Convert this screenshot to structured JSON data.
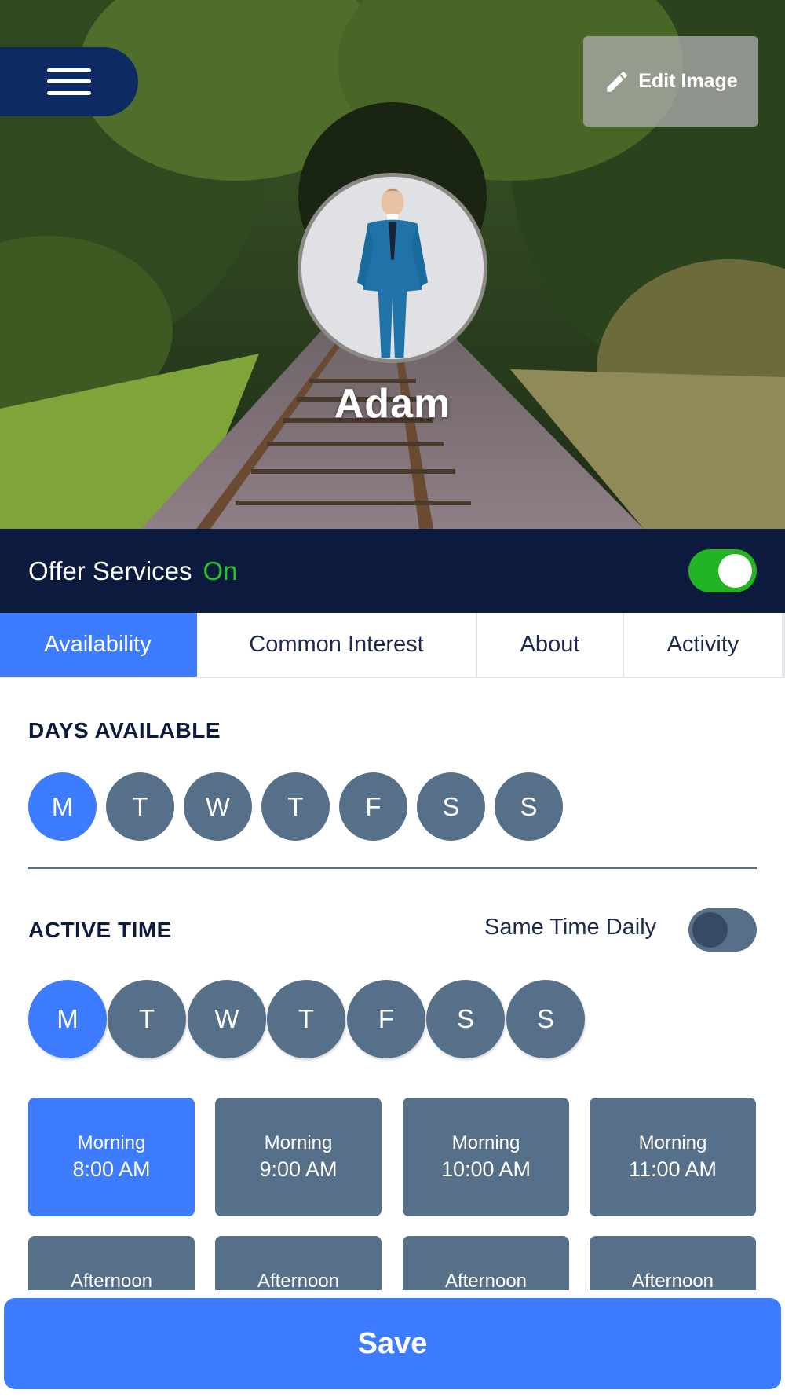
{
  "header": {
    "menu_icon": "hamburger-menu-icon",
    "edit_image_label": "Edit Image",
    "edit_icon": "pencil-icon",
    "profile_name": "Adam"
  },
  "offer_services": {
    "label": "Offer Services",
    "status": "On",
    "enabled": true,
    "status_color": "#27c227"
  },
  "tabs": [
    {
      "label": "Availability",
      "active": true
    },
    {
      "label": "Common Interest",
      "active": false
    },
    {
      "label": "About",
      "active": false
    },
    {
      "label": "Activity",
      "active": false
    }
  ],
  "days_available": {
    "title": "DAYS AVAILABLE",
    "days": [
      {
        "label": "M",
        "selected": true
      },
      {
        "label": "T",
        "selected": false
      },
      {
        "label": "W",
        "selected": false
      },
      {
        "label": "T",
        "selected": false
      },
      {
        "label": "F",
        "selected": false
      },
      {
        "label": "S",
        "selected": false
      },
      {
        "label": "S",
        "selected": false
      }
    ]
  },
  "active_time": {
    "title": "ACTIVE TIME",
    "same_time_daily_label": "Same Time Daily",
    "same_time_daily_enabled": false,
    "days": [
      {
        "label": "M",
        "selected": true
      },
      {
        "label": "T",
        "selected": false
      },
      {
        "label": "W",
        "selected": false
      },
      {
        "label": "T",
        "selected": false
      },
      {
        "label": "F",
        "selected": false
      },
      {
        "label": "S",
        "selected": false
      },
      {
        "label": "S",
        "selected": false
      }
    ],
    "slots": [
      {
        "period": "Morning",
        "time": "8:00 AM",
        "selected": true
      },
      {
        "period": "Morning",
        "time": "9:00 AM",
        "selected": false
      },
      {
        "period": "Morning",
        "time": "10:00 AM",
        "selected": false
      },
      {
        "period": "Morning",
        "time": "11:00 AM",
        "selected": false
      },
      {
        "period": "Afternoon",
        "time": "",
        "selected": false
      },
      {
        "period": "Afternoon",
        "time": "",
        "selected": false
      },
      {
        "period": "Afternoon",
        "time": "",
        "selected": false
      },
      {
        "period": "Afternoon",
        "time": "",
        "selected": false
      }
    ]
  },
  "save_label": "Save",
  "colors": {
    "navy": "#0b1a3d",
    "accent_blue": "#3d7bff",
    "slate": "#577089",
    "toggle_green": "#22b422"
  }
}
